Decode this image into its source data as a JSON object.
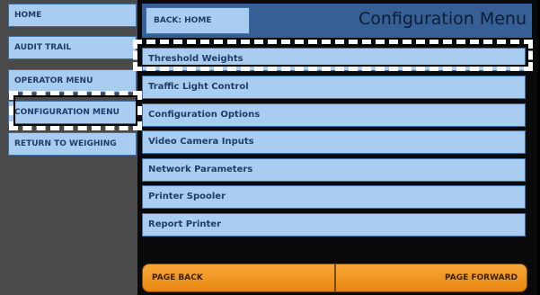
{
  "sidebar": {
    "items": [
      {
        "label": "HOME"
      },
      {
        "label": "AUDIT TRAIL"
      },
      {
        "label": "OPERATOR MENU"
      },
      {
        "label": "CONFIGURATION MENU"
      },
      {
        "label": "RETURN TO WEIGHING"
      }
    ]
  },
  "header": {
    "back_label": "BACK: HOME",
    "title": "Configuration Menu"
  },
  "menu": {
    "items": [
      {
        "label": "Threshold Weights"
      },
      {
        "label": "Traffic Light Control"
      },
      {
        "label": "Configuration Options"
      },
      {
        "label": "Video Camera Inputs"
      },
      {
        "label": "Network Parameters"
      },
      {
        "label": "Printer Spooler"
      },
      {
        "label": "Report Printer"
      }
    ]
  },
  "paging": {
    "back_label": "PAGE BACK",
    "forward_label": "PAGE FORWARD"
  },
  "colors": {
    "button_fill": "#a9cdf0",
    "header_fill": "#355f95",
    "page_button_fill": "#f29a25",
    "highlight": "#ffffff"
  }
}
